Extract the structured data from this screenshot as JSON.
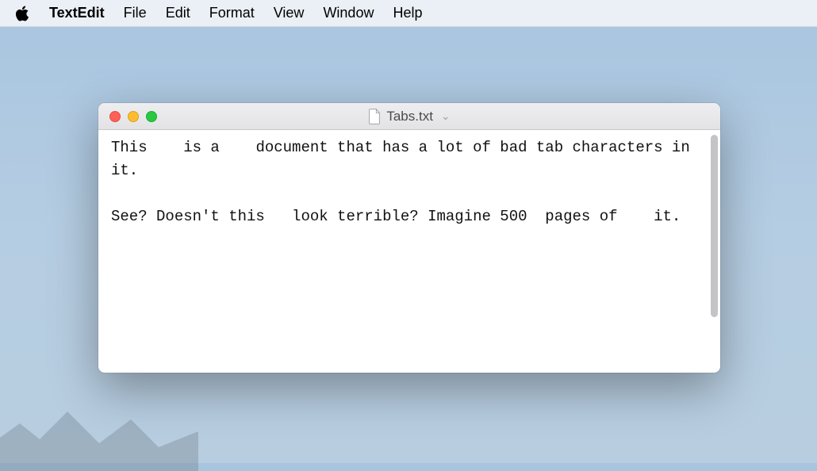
{
  "menubar": {
    "app_name": "TextEdit",
    "items": [
      "File",
      "Edit",
      "Format",
      "View",
      "Window",
      "Help"
    ]
  },
  "window": {
    "title": "Tabs.txt",
    "document_text": "This\tis a\tdocument that has a lot of bad tab characters in it.\n\nSee? Doesn't this\tlook terrible? Imagine 500\tpages of\tit."
  }
}
